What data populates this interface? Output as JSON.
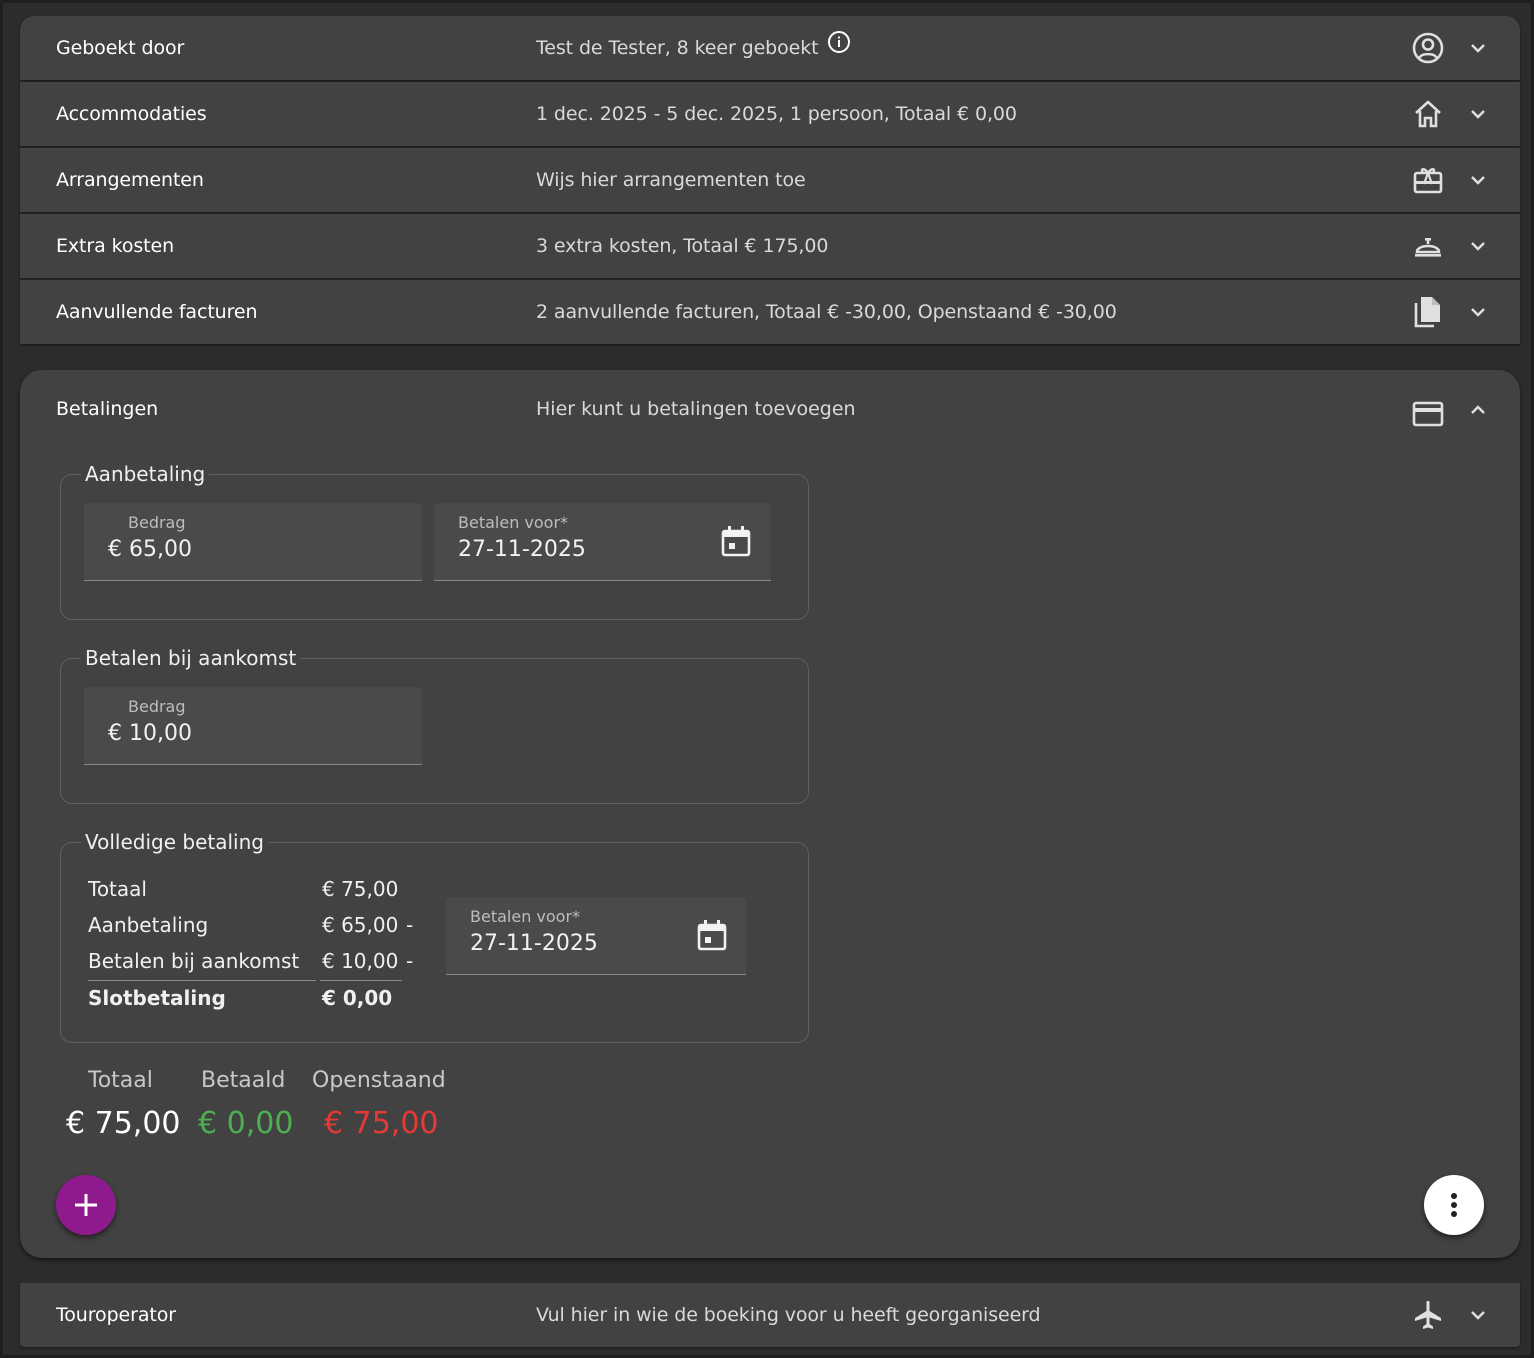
{
  "colors": {
    "panel_bg": "#424242",
    "page_bg": "#2c2c2c",
    "fab_bg": "#8e1a8e",
    "paid_green": "#4caf50",
    "outstanding_red": "#e53935"
  },
  "panels": [
    {
      "title": "Geboekt door",
      "description": "Test de Tester, 8 keer geboekt",
      "icon": "account-circle-icon"
    },
    {
      "title": "Accommodaties",
      "description": "1 dec. 2025 - 5 dec. 2025, 1 persoon, Totaal € 0,00",
      "icon": "home-icon"
    },
    {
      "title": "Arrangementen",
      "description": "Wijs hier arrangementen toe",
      "icon": "gift-card-icon"
    },
    {
      "title": "Extra kosten",
      "description": "3 extra kosten, Totaal € 175,00",
      "icon": "room-service-icon"
    },
    {
      "title": "Aanvullende facturen",
      "description": "2 aanvullende facturen, Totaal € -30,00, Openstaand € -30,00",
      "icon": "file-copy-icon"
    }
  ],
  "payments": {
    "title": "Betalingen",
    "description": "Hier kunt u betalingen toevoegen",
    "icon": "credit-card-icon",
    "deposit": {
      "legend": "Aanbetaling",
      "amount_label": "Bedrag",
      "amount_value": "€ 65,00",
      "date_label": "Betalen voor*",
      "date_value": "27-11-2025"
    },
    "on_arrival": {
      "legend": "Betalen bij aankomst",
      "amount_label": "Bedrag",
      "amount_value": "€ 10,00"
    },
    "full": {
      "legend": "Volledige betaling",
      "rows": [
        {
          "label": "Totaal",
          "value": "€ 75,00",
          "mark": ""
        },
        {
          "label": "Aanbetaling",
          "value": "€ 65,00",
          "mark": "-"
        },
        {
          "label": "Betalen bij aankomst",
          "value": "€ 10,00",
          "mark": "-"
        },
        {
          "label": "Slotbetaling",
          "value": "€ 0,00",
          "mark": ""
        }
      ],
      "date_label": "Betalen voor*",
      "date_value": "27-11-2025"
    },
    "totals": {
      "total_label": "Totaal",
      "total_value": "€ 75,00",
      "paid_label": "Betaald",
      "paid_value": "€ 0,00",
      "outstanding_label": "Openstaand",
      "outstanding_value": "€ 75,00"
    },
    "add_button": "+",
    "more_button_icon": "more-vert-icon"
  },
  "touroperator": {
    "title": "Touroperator",
    "description": "Vul hier in wie de boeking voor u heeft georganiseerd",
    "icon": "airplane-icon"
  }
}
